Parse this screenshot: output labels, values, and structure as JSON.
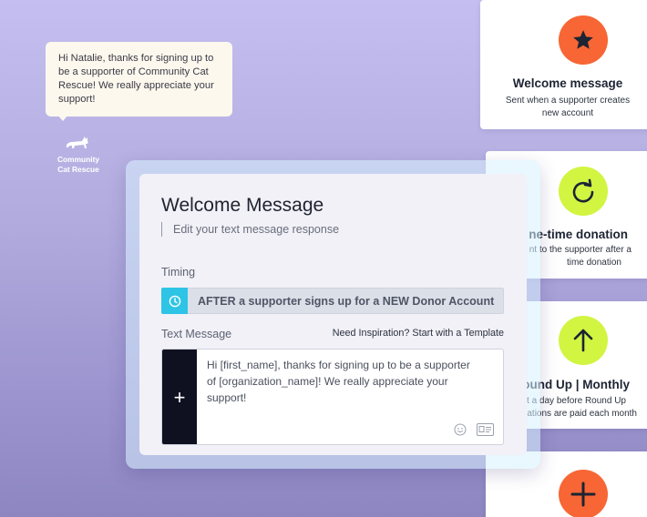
{
  "bubble": {
    "message": "Hi Natalie, thanks for signing up to be a supporter of Community Cat Rescue! We really appreciate your support!"
  },
  "org_logo": {
    "line1": "Community",
    "line2": "Cat Rescue",
    "icon": "cat-icon"
  },
  "panel": {
    "title": "Welcome Message",
    "subtitle": "Edit your text message response",
    "timing_label": "Timing",
    "timing_value": "AFTER a supporter signs up for a NEW Donor Account",
    "timing_icon": "clock-icon",
    "message_label": "Text Message",
    "inspiration_link": "Need Inspiration? Start with a Template",
    "message_body": "Hi [first_name], thanks for signing up to be a supporter of [organization_name]! We really appreciate your support!",
    "add_symbol": "+",
    "emoji_icon": "smiley-icon",
    "template_icon": "contact-card-icon"
  },
  "cards": [
    {
      "icon": "star-icon",
      "color": "#f76634",
      "title": "Welcome message",
      "desc_lines": [
        "Sent when a supporter creates",
        "new account"
      ]
    },
    {
      "icon": "refresh-icon",
      "color": "#d1f541",
      "title": "ne-time donation",
      "desc_lines": [
        "nt to the supporter after a",
        "time donation"
      ]
    },
    {
      "icon": "arrow-up-icon",
      "color": "#d1f541",
      "title": "ound Up | Monthly",
      "desc_lines": [
        "nt a day before Round Up",
        "ations are paid each month"
      ]
    },
    {
      "icon": "plus-icon",
      "color": "#f76634"
    }
  ],
  "colors": {
    "accent_orange": "#f76634",
    "accent_lime": "#d1f541",
    "accent_cyan": "#2ec4e6",
    "dark_strip": "#0f1020"
  }
}
